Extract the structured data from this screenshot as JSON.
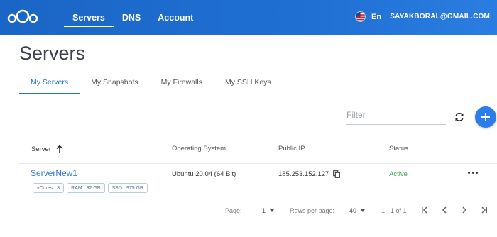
{
  "header": {
    "nav": [
      {
        "label": "Servers",
        "active": true
      },
      {
        "label": "DNS",
        "active": false
      },
      {
        "label": "Account",
        "active": false
      }
    ],
    "language": "En",
    "email": "SAYAKBORAL@GMAIL.COM"
  },
  "page": {
    "title": "Servers"
  },
  "tabs": [
    {
      "label": "My Servers",
      "active": true
    },
    {
      "label": "My Snapshots",
      "active": false
    },
    {
      "label": "My Firewalls",
      "active": false
    },
    {
      "label": "My SSH Keys",
      "active": false
    }
  ],
  "filter": {
    "placeholder": "Filter"
  },
  "table": {
    "headers": {
      "server": "Server",
      "os": "Operating System",
      "ip": "Public IP",
      "status": "Status"
    },
    "rows": [
      {
        "name": "ServerNew1",
        "os": "Ubuntu 20.04 (64 Bit)",
        "ip": "185.253.152.127",
        "status": "Active",
        "specs": [
          {
            "label": "vCores",
            "value": "8"
          },
          {
            "label": "RAM",
            "value": "32 GB"
          },
          {
            "label": "SSD",
            "value": "975 GB"
          }
        ]
      }
    ]
  },
  "pagination": {
    "page_label": "Page:",
    "page_value": "1",
    "rows_label": "Rows per page:",
    "rows_value": "40",
    "range": "1 - 1 of 1"
  },
  "colors": {
    "header_blue": "#1f6fd3",
    "link_blue": "#2c77d4",
    "status_green": "#3aa757"
  }
}
